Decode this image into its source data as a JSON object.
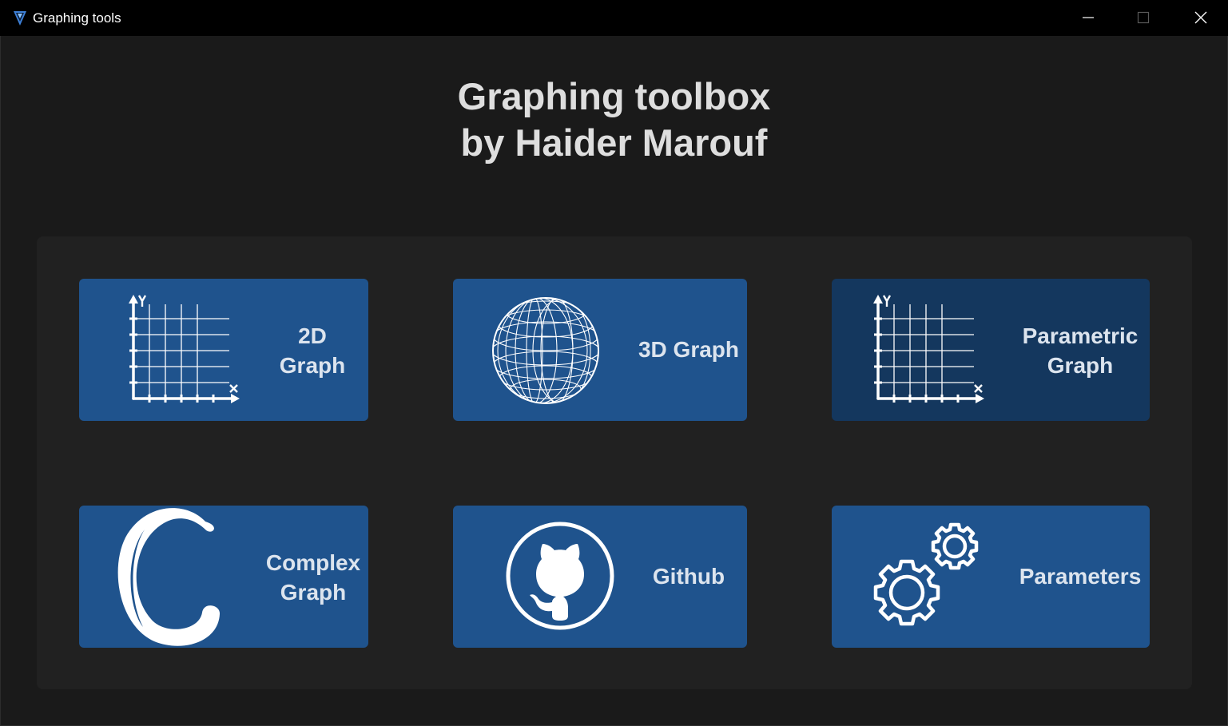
{
  "window": {
    "title": "Graphing tools",
    "app_icon": "v-logo-icon",
    "controls": [
      "minimize-icon",
      "maximize-icon",
      "close-icon"
    ]
  },
  "heading": {
    "line1": "Graphing toolbox",
    "line2": "by Haider Marouf"
  },
  "tiles": [
    {
      "label": "2D\nGraph",
      "icon": "2d-graph-icon",
      "state": "normal"
    },
    {
      "label": "3D Graph",
      "icon": "sphere-icon",
      "state": "normal"
    },
    {
      "label": "Parametric\nGraph",
      "icon": "2d-graph-icon",
      "state": "selected"
    },
    {
      "label": "Complex\nGraph",
      "icon": "complex-c-icon",
      "state": "normal"
    },
    {
      "label": "Github",
      "icon": "github-icon",
      "state": "normal"
    },
    {
      "label": "Parameters",
      "icon": "gears-icon",
      "state": "normal"
    }
  ],
  "colors": {
    "background": "#1a1a1a",
    "panel": "#212121",
    "tile": "#1f538d",
    "tile_selected": "#14375e",
    "text": "#dce4ee"
  }
}
